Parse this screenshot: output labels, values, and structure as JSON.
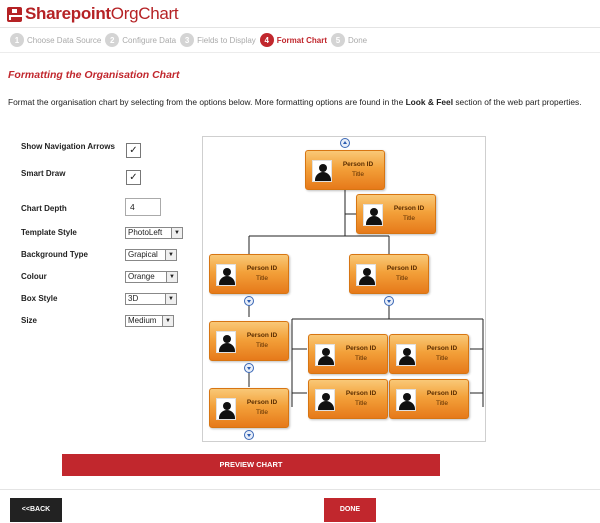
{
  "app": {
    "logo_bold": "Sharepoint",
    "logo_regular": "OrgChart"
  },
  "steps": [
    {
      "num": "1",
      "label": "Choose Data Source",
      "active": false
    },
    {
      "num": "2",
      "label": "Configure Data",
      "active": false
    },
    {
      "num": "3",
      "label": "Fields to Display",
      "active": false
    },
    {
      "num": "4",
      "label": "Format Chart",
      "active": true
    },
    {
      "num": "5",
      "label": "Done",
      "active": false
    }
  ],
  "section": {
    "title": "Formatting the Organisation Chart",
    "desc_before": "Format the organisation chart by selecting from the options below. More formatting options are found in the ",
    "desc_bold": "Look & Feel",
    "desc_after": " section of the web part properties."
  },
  "form": {
    "show_nav_label": "Show Navigation Arrows",
    "show_nav_checked": "✓",
    "smart_draw_label": "Smart Draw",
    "smart_draw_checked": "✓",
    "depth_label": "Chart Depth",
    "depth_value": "4",
    "template_label": "Template Style",
    "template_value": "PhotoLeft",
    "background_label": "Background Type",
    "background_value": "Grapical",
    "colour_label": "Colour",
    "colour_value": "Orange",
    "boxstyle_label": "Box Style",
    "boxstyle_value": "3D",
    "size_label": "Size",
    "size_value": "Medium"
  },
  "node": {
    "name": "Person ID",
    "title": "Title"
  },
  "colors": {
    "accent": "#c1272d",
    "node_orange": "#f3a13a",
    "back_button": "#222222"
  },
  "buttons": {
    "preview": "PREVIEW CHART",
    "back": "<<BACK",
    "done": "DONE"
  }
}
